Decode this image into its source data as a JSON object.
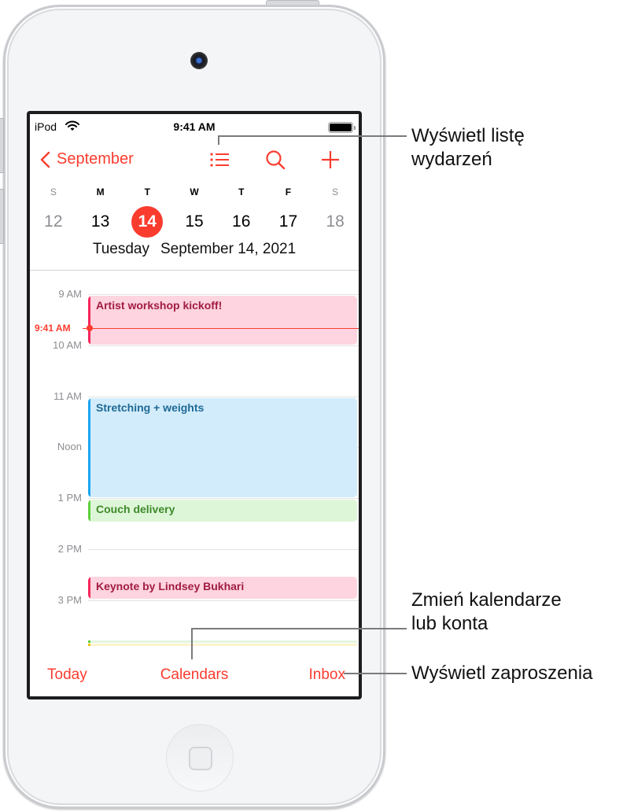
{
  "status_bar": {
    "carrier": "iPod",
    "time": "9:41 AM",
    "wifi_icon": "wifi-icon",
    "battery_icon": "battery-full-icon"
  },
  "nav": {
    "back_label": "September",
    "back_icon": "chevron-left-icon",
    "list_icon": "list-view-icon",
    "search_icon": "search-icon",
    "add_icon": "plus-icon"
  },
  "week": {
    "weekdays": [
      "S",
      "M",
      "T",
      "W",
      "T",
      "F",
      "S"
    ],
    "dates": [
      "12",
      "13",
      "14",
      "15",
      "16",
      "17",
      "18"
    ],
    "selected_index": 2
  },
  "selected_date": {
    "weekday": "Tuesday",
    "date": "September 14, 2021"
  },
  "timeline": {
    "hours": [
      "9 AM",
      "10 AM",
      "11 AM",
      "Noon",
      "1 PM",
      "2 PM",
      "3 PM"
    ],
    "now_label": "9:41 AM",
    "events": [
      {
        "title": "Artist workshop kickoff!",
        "color": "pink"
      },
      {
        "title": "Stretching + weights",
        "color": "blue"
      },
      {
        "title": "Couch delivery",
        "color": "green"
      },
      {
        "title": "Keynote by Lindsey Bukhari",
        "color": "pink"
      }
    ]
  },
  "tabbar": {
    "today": "Today",
    "calendars": "Calendars",
    "inbox": "Inbox"
  },
  "callouts": {
    "list_view": [
      "Wyświetl listę",
      "wydarzeń"
    ],
    "calendars": [
      "Zmień kalendarze",
      "lub konta"
    ],
    "inbox": [
      "Wyświetl zaproszenia"
    ]
  },
  "colors": {
    "accent": "#fa3c2f",
    "event_pink": "#fdd4df",
    "event_blue": "#d2ecfb",
    "event_green": "#def6d8"
  }
}
